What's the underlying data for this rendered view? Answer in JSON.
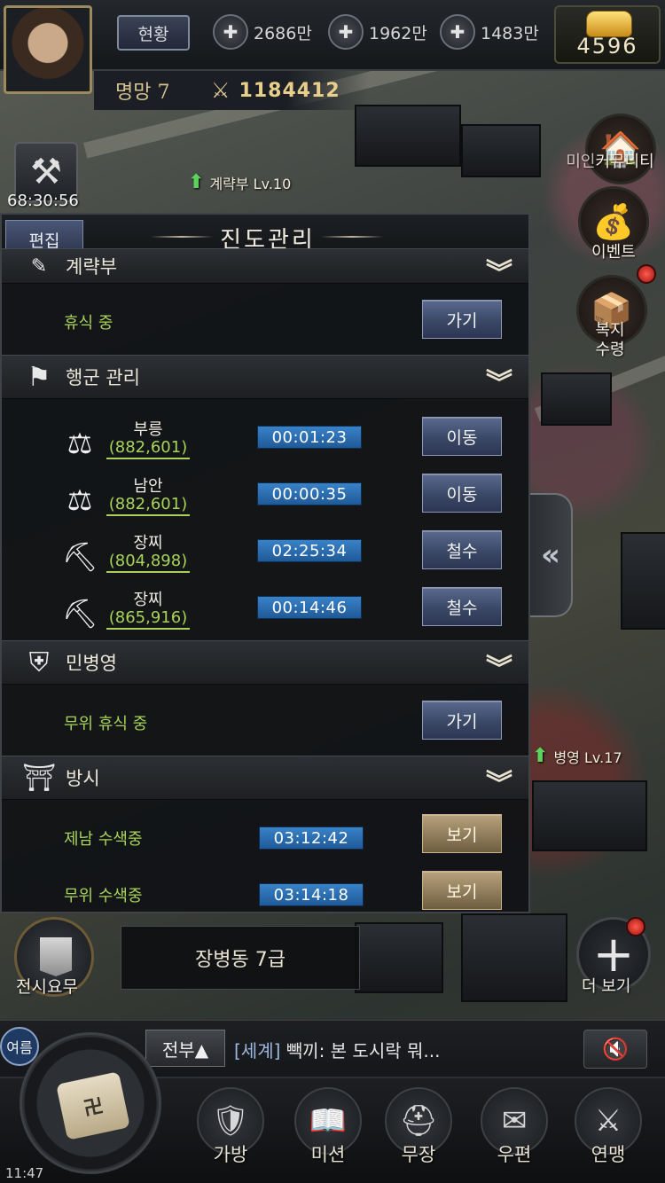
{
  "topbar": {
    "status_label": "현황",
    "resources": [
      {
        "icon": "grain-icon",
        "value": "2686만"
      },
      {
        "icon": "coin-icon",
        "value": "1962만"
      },
      {
        "icon": "stone-icon",
        "value": "1483만"
      }
    ],
    "gold": "4596",
    "fame": "명망 7",
    "power": "1184412"
  },
  "map": {
    "build_timer": "68:30:56",
    "labels": {
      "strategy": "계략부 Lv.10",
      "barracks": "병영  Lv.17"
    }
  },
  "right_buttons": {
    "community": "커뮤니티",
    "community_prefix": "미인",
    "event": "이벤트",
    "welfare_line1": "복지",
    "welfare_line2": "수령"
  },
  "panel": {
    "edit_label": "편집",
    "title": "진도관리",
    "sections": {
      "top_partial": "계략부",
      "top_status": "휴식 중",
      "top_button": "가기",
      "march": {
        "title": "행군 관리",
        "rows": [
          {
            "name": "부릉",
            "coord": "(882,601)",
            "time": "00:01:23",
            "action": "이동",
            "icon": "scale-icon"
          },
          {
            "name": "남안",
            "coord": "(882,601)",
            "time": "00:00:35",
            "action": "이동",
            "icon": "scale-icon"
          },
          {
            "name": "장찌",
            "coord": "(804,898)",
            "time": "02:25:34",
            "action": "철수",
            "icon": "pickaxe-icon"
          },
          {
            "name": "장찌",
            "coord": "(865,916)",
            "time": "00:14:46",
            "action": "철수",
            "icon": "pickaxe-icon"
          }
        ]
      },
      "militia": {
        "title": "민병영",
        "status": "무위 휴식 중",
        "button": "가기"
      },
      "market": {
        "title": "방시",
        "rows": [
          {
            "status": "제남 수색중",
            "time": "03:12:42",
            "button": "보기"
          },
          {
            "status": "무위 수색중",
            "time": "03:14:18",
            "button": "보기"
          }
        ]
      }
    }
  },
  "quest": {
    "label": "전시요무",
    "tip": "장병동 7급"
  },
  "more_label": "더 보기",
  "chat": {
    "side_tag": "여름",
    "filter": "전부▲",
    "channel": "[세계]",
    "message": " 빽끼: 본 도시락 뭐..."
  },
  "nav": [
    {
      "label": "가방",
      "icon": "armor-icon"
    },
    {
      "label": "미션",
      "icon": "book-icon"
    },
    {
      "label": "무장",
      "icon": "helmet-icon"
    },
    {
      "label": "우편",
      "icon": "mail-icon"
    },
    {
      "label": "연맹",
      "icon": "alliance-icon"
    }
  ],
  "clock": "11:47"
}
